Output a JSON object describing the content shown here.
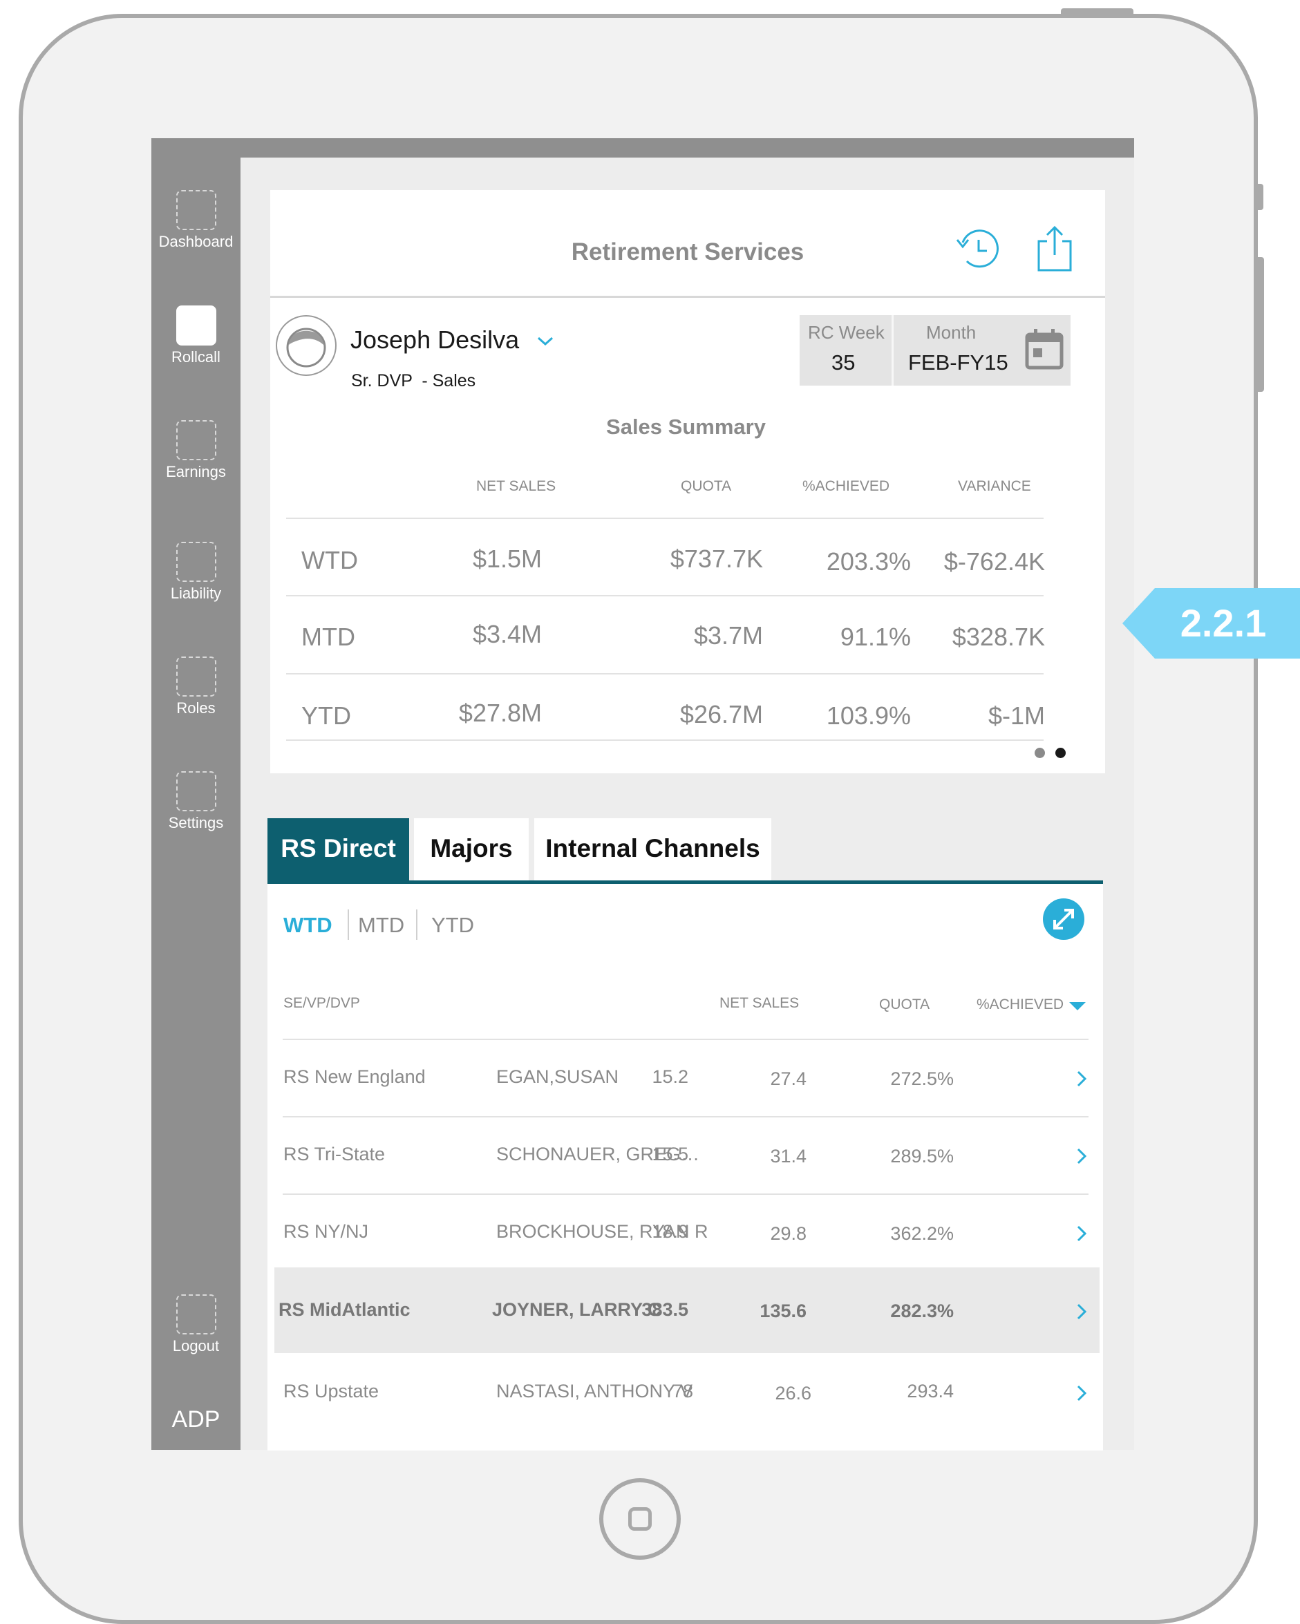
{
  "sidebar": {
    "items": [
      {
        "label": "Dashboard"
      },
      {
        "label": "Rollcall"
      },
      {
        "label": "Earnings"
      },
      {
        "label": "Liability"
      },
      {
        "label": "Roles"
      },
      {
        "label": "Settings"
      },
      {
        "label": "Logout"
      }
    ],
    "brand": "ADP"
  },
  "header": {
    "title": "Retirement Services"
  },
  "user": {
    "name": "Joseph Desilva",
    "role": "Sr. DVP  - Sales"
  },
  "period_selector": {
    "week_label": "RC Week",
    "week_value": "35",
    "month_label": "Month",
    "month_value": "FEB-FY15"
  },
  "summary": {
    "title": "Sales Summary",
    "columns": [
      "NET SALES",
      "QUOTA",
      "%ACHIEVED",
      "VARIANCE"
    ],
    "rows": [
      {
        "period": "WTD",
        "net_sales": "$1.5M",
        "quota": "$737.7K",
        "achieved": "203.3%",
        "variance": "$-762.4K"
      },
      {
        "period": "MTD",
        "net_sales": "$3.4M",
        "quota": "$3.7M",
        "achieved": "91.1%",
        "variance": "$328.7K"
      },
      {
        "period": "YTD",
        "net_sales": "$27.8M",
        "quota": "$26.7M",
        "achieved": "103.9%",
        "variance": "$-1M"
      }
    ],
    "pager": {
      "pages": 2,
      "current": 2
    }
  },
  "tabs": [
    {
      "label": "RS Direct",
      "active": true
    },
    {
      "label": "Majors",
      "active": false
    },
    {
      "label": "Internal Channels",
      "active": false
    }
  ],
  "periods": [
    {
      "label": "WTD",
      "active": true
    },
    {
      "label": "MTD",
      "active": false
    },
    {
      "label": "YTD",
      "active": false
    }
  ],
  "table": {
    "columns": {
      "region": "SE/VP/DVP",
      "net_sales": "NET SALES",
      "quota": "QUOTA",
      "achieved": "%ACHIEVED"
    },
    "sort": {
      "column": "achieved",
      "direction": "desc"
    },
    "rows": [
      {
        "region": "RS New England",
        "name": "EGAN,SUSAN",
        "net_sales": "15.2",
        "quota": "27.4",
        "achieved": "272.5%"
      },
      {
        "region": "RS Tri-State",
        "name": "SCHONAUER, GREG…",
        "net_sales": "15.5",
        "quota": "31.4",
        "achieved": "289.5%"
      },
      {
        "region": "RS NY/NJ",
        "name": "BROCKHOUSE, RYAN R",
        "net_sales": "18.9",
        "quota": "29.8",
        "achieved": "362.2%"
      },
      {
        "region": "RS MidAtlantic",
        "name": "JOYNER, LARRY C",
        "net_sales": "383.5",
        "quota": "135.6",
        "achieved": "282.3%"
      },
      {
        "region": "RS Upstate",
        "name": "NASTASI, ANTHONY V",
        "net_sales": "78",
        "quota": "26.6",
        "achieved": "293.4"
      }
    ],
    "highlighted_row": 3
  },
  "annotation": {
    "label": "2.2.1"
  },
  "colors": {
    "accent": "#2aaed8",
    "tab_active": "#0d5f6f",
    "sidebar": "#8f8f8f",
    "callout": "#7dd6f7",
    "text_muted": "#8a8a8a"
  },
  "icons": {
    "history": "history-icon",
    "share": "share-icon",
    "calendar": "calendar-icon",
    "expand": "expand-icon",
    "dropdown": "chevron-down-icon",
    "row": "chevron-right-icon"
  }
}
